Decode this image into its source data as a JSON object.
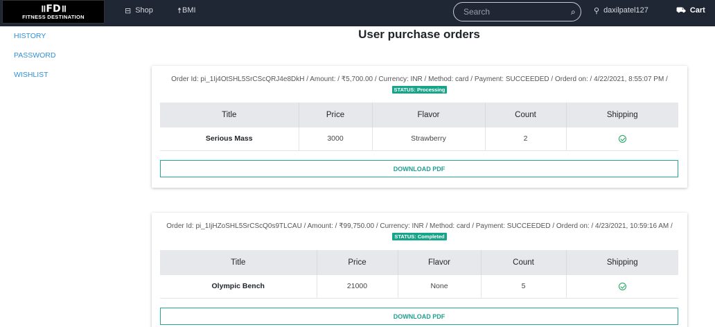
{
  "navbar": {
    "logo_mark": "॥FD॥",
    "logo_sub": "FITNESS DESTINATION",
    "shop_label": "Shop",
    "bmi_label": "BMI",
    "search_placeholder": "Search",
    "user_label": "daxilpatel127",
    "cart_label": "Cart"
  },
  "sidebar": {
    "items": [
      "HISTORY",
      "PASSWORD",
      "WISHLIST"
    ]
  },
  "page_title": "User purchase orders",
  "table_headers": [
    "Title",
    "Price",
    "Flavor",
    "Count",
    "Shipping"
  ],
  "download_label": "DOWNLOAD PDF",
  "orders": [
    {
      "info": "Order Id: pi_1Ij4OtSHL5SrCScQRJ4e8DkH / Amount: / ₹5,700.00 / Currency: INR / Method: card / Payment: SUCCEEDED / Orderd on: / 4/22/2021, 8:55:07 PM /",
      "status": "STATUS: Processing",
      "items": [
        {
          "title": "Serious Mass",
          "price": "3000",
          "flavor": "Strawberry",
          "count": "2"
        }
      ]
    },
    {
      "info": "Order Id: pi_1IjHZoSHL5SrCScQ0s9TLCAU / Amount: / ₹99,750.00 / Currency: INR / Method: card / Payment: SUCCEEDED / Orderd on: / 4/23/2021, 10:59:16 AM /",
      "status": "STATUS: Completed",
      "items": [
        {
          "title": "Olympic Bench",
          "price": "21000",
          "flavor": "None",
          "count": "5"
        }
      ]
    }
  ],
  "colors": {
    "navbar_bg": "#1f2634",
    "link": "#2f8fd5",
    "status_badge": "#17a589",
    "download_border": "#21a896",
    "shipped_check": "#1aa35a"
  }
}
